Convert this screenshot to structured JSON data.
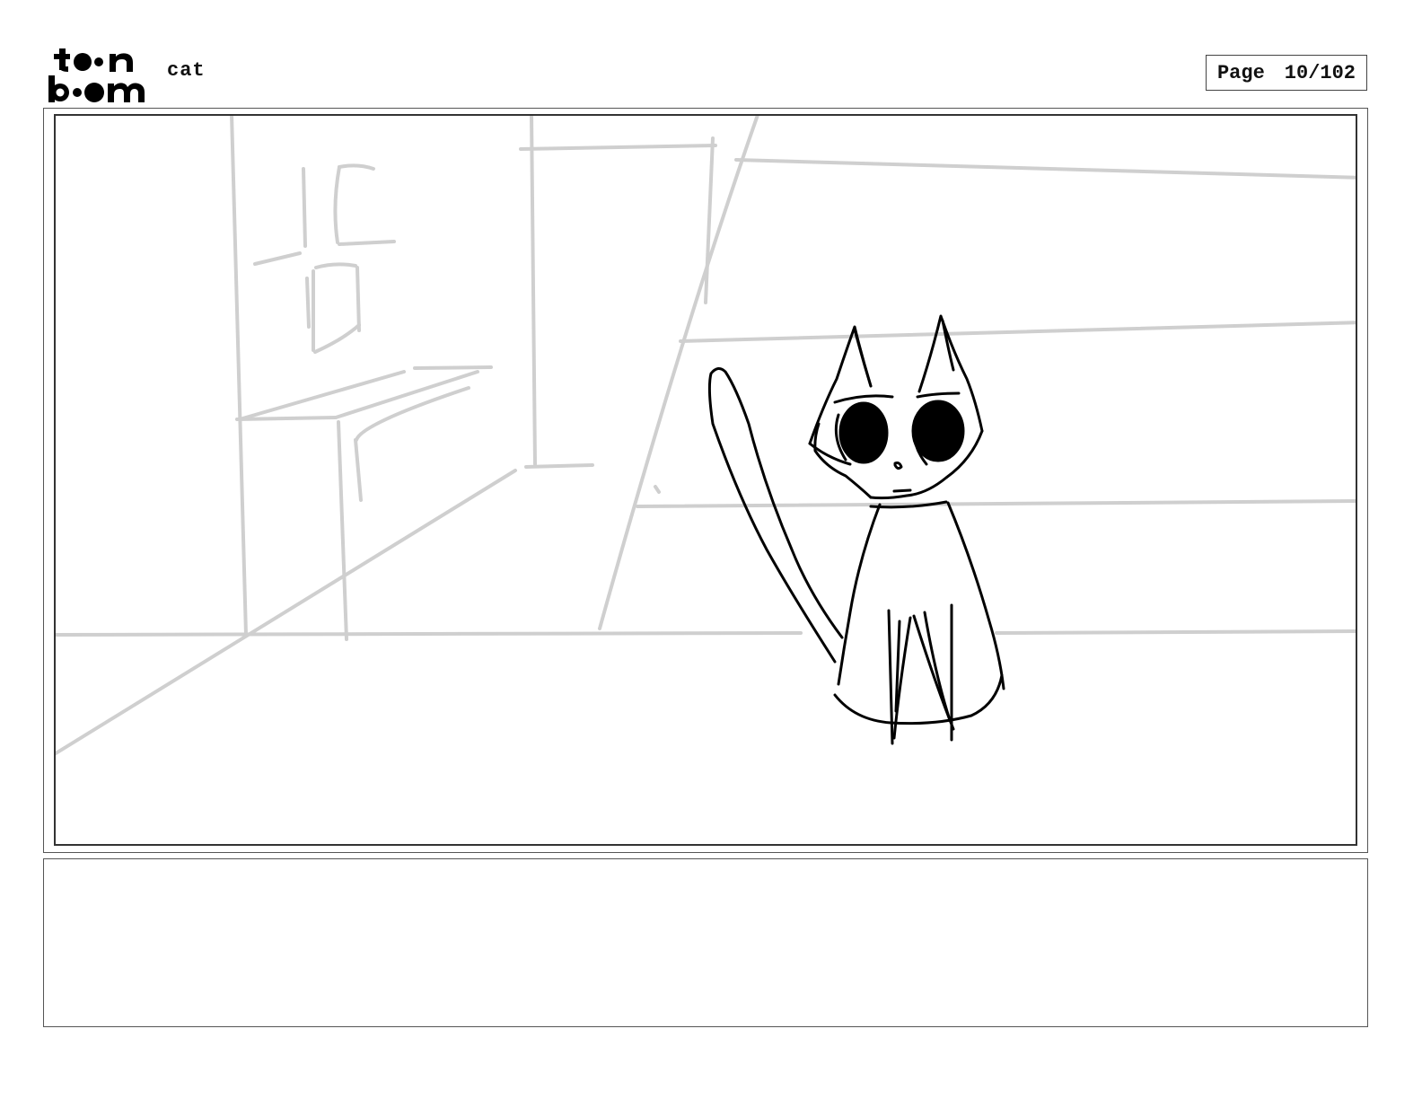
{
  "header": {
    "logo": {
      "line1": "toon",
      "line2": "boom"
    },
    "project_title": "cat",
    "page_label": "Page",
    "page_number": "10/102"
  },
  "panel": {
    "content": "sketch",
    "background_lines_color": "#cfcfcf",
    "character_lines_color": "#000000"
  },
  "notes": {
    "text": ""
  }
}
